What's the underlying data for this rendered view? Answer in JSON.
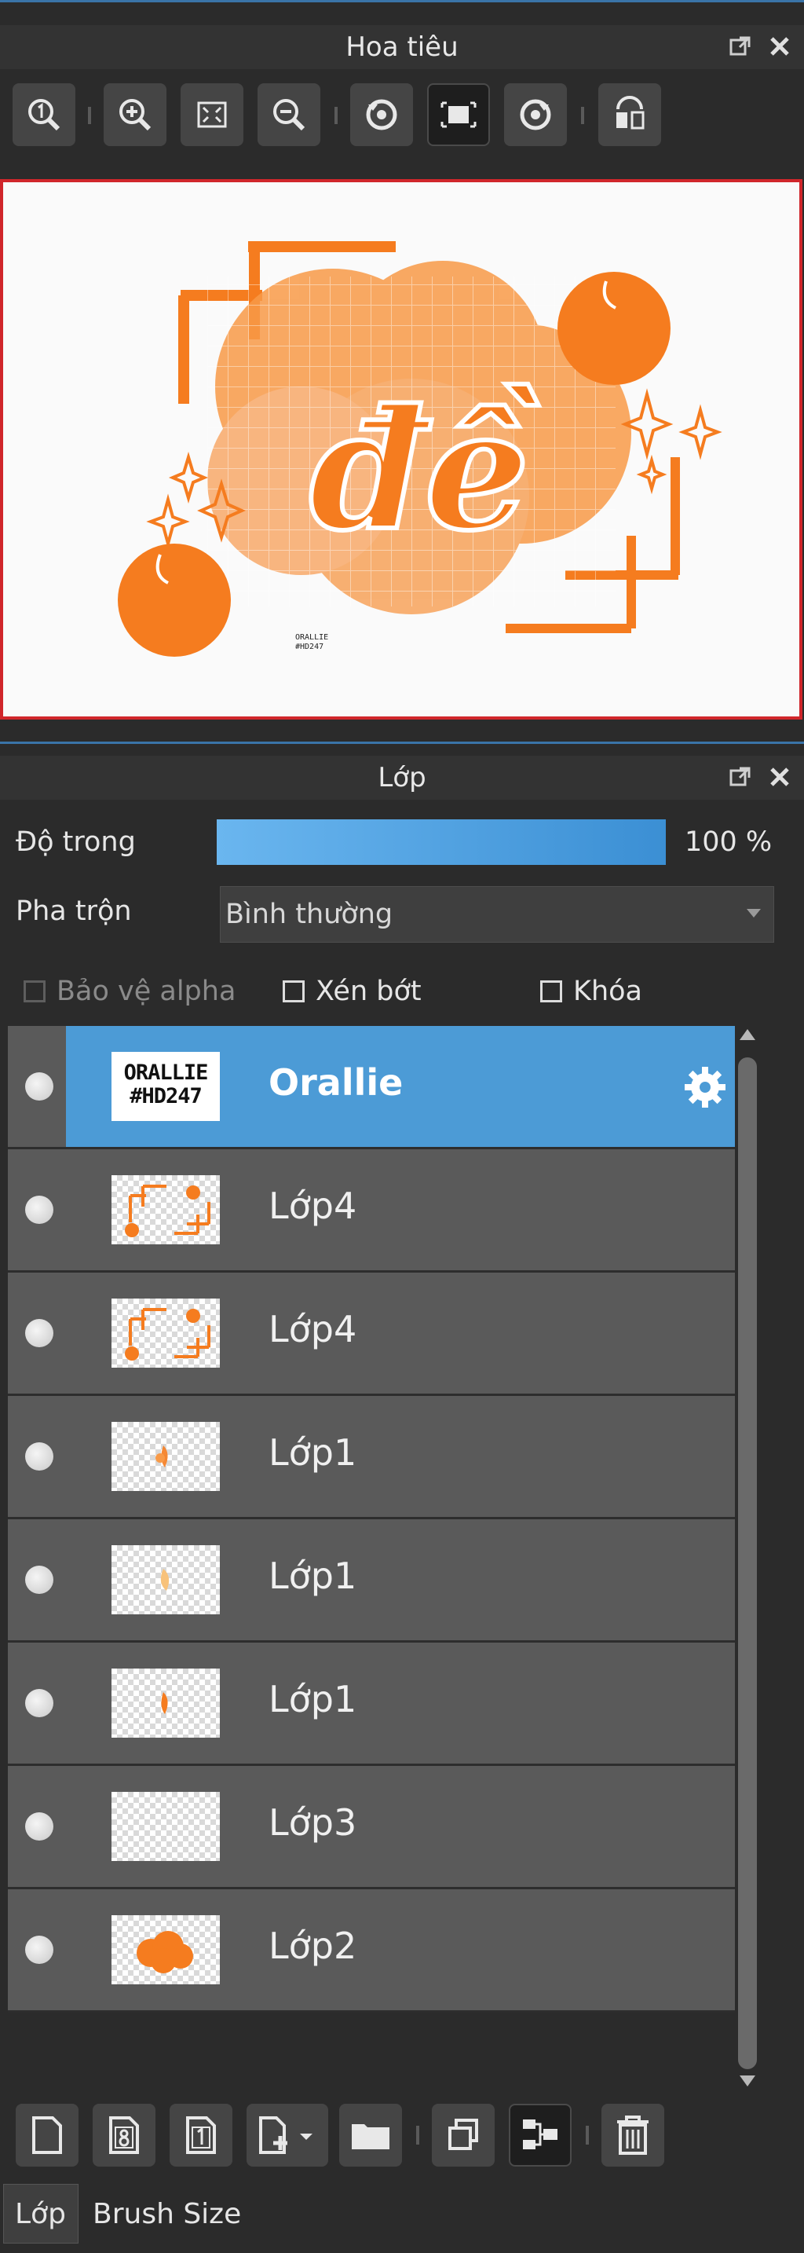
{
  "navigator": {
    "title": "Hoa tiêu",
    "preview": {
      "big_letters": "đề",
      "signature_line1": "ORALLIE",
      "signature_line2": "#HD247"
    }
  },
  "layers_panel": {
    "title": "Lớp",
    "opacity_label": "Độ trong",
    "opacity_value": "100 %",
    "opacity_fraction": 1.0,
    "blend_label": "Pha trộn",
    "blend_value": "Bình thường",
    "checkboxes": {
      "alpha": "Bảo vệ alpha",
      "clip": "Xén bớt",
      "lock": "Khóa"
    },
    "layers": [
      {
        "name": "Orallie",
        "thumb_text_1": "ORALLIE",
        "thumb_text_2": "#HD247",
        "selected": true
      },
      {
        "name": "Lớp4"
      },
      {
        "name": "Lớp4"
      },
      {
        "name": "Lớp1"
      },
      {
        "name": "Lớp1"
      },
      {
        "name": "Lớp1"
      },
      {
        "name": "Lớp3"
      },
      {
        "name": "Lớp2"
      }
    ]
  },
  "tabs": [
    "Lớp",
    "Brush Size"
  ],
  "colors": {
    "accent_orange": "#f57c1f",
    "selected_row": "#4c9bd6",
    "preview_border": "#d0262b"
  }
}
